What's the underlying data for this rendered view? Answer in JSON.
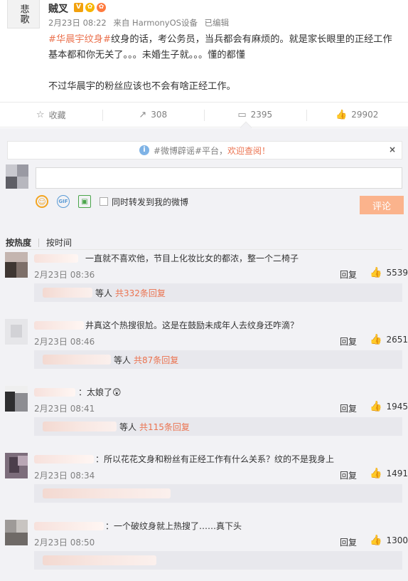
{
  "post": {
    "avatar_glyph": "悲歌",
    "username": "贼叉",
    "badges": [
      "V",
      "✿",
      "✿"
    ],
    "date": "2月23日 08:22",
    "source": "来自 HarmonyOS设备",
    "edited": "已编辑",
    "hashtag": "#华晨宇纹身#",
    "text_1": "纹身的话，考公务员，当兵都会有麻烦的。就是家长眼里的正经工作基本都和你无关了。。。未婚生子就。。。懂的都懂",
    "text_2": "不过华晨宇的粉丝应该也不会有啥正经工作。"
  },
  "actions": [
    {
      "icon": "☆",
      "label": "收藏"
    },
    {
      "icon": "↗",
      "label": "308"
    },
    {
      "icon": "▭",
      "label": "2395"
    },
    {
      "icon": "👍",
      "label": "29902"
    }
  ],
  "notice": {
    "prefix": "#微博辟谣#平台，",
    "highlight": "欢迎查阅！",
    "close": "×"
  },
  "composer": {
    "tool_emoji": "☺",
    "tool_gif": "GIF",
    "tool_pic": "▣",
    "repost_label": "同时转发到我的微博",
    "submit_label": "评论"
  },
  "sort": {
    "hot": "按热度",
    "time": "按时间"
  },
  "comments": [
    {
      "text": "一直就不喜欢他，节目上化妆比女的都浓，整一个二椅子",
      "time": "2月23日 08:36",
      "reply": "回复",
      "likes": "5539",
      "sub_suffix": "等人",
      "sub_count": "共332条回复"
    },
    {
      "text": "井真这个热搜很尬。这是在鼓励未成年人去纹身还咋滴？",
      "time": "2月23日 08:46",
      "reply": "回复",
      "likes": "2651",
      "sub_suffix": "等人",
      "sub_count": "共87条回复"
    },
    {
      "text": "：太娘了😲",
      "time": "2月23日 08:41",
      "reply": "回复",
      "likes": "1945",
      "sub_suffix": "等人",
      "sub_count": "共115条回复"
    },
    {
      "text": "：所以花花文身和粉丝有正经工作有什么关系？纹的不是我身上",
      "time": "2月23日 08:34",
      "reply": "回复",
      "likes": "1491",
      "sub_suffix": "",
      "sub_count": ""
    },
    {
      "text": "：一个破纹身就上热搜了……真下头",
      "time": "2月23日 08:50",
      "reply": "回复",
      "likes": "1300",
      "sub_suffix": "",
      "sub_count": ""
    }
  ]
}
